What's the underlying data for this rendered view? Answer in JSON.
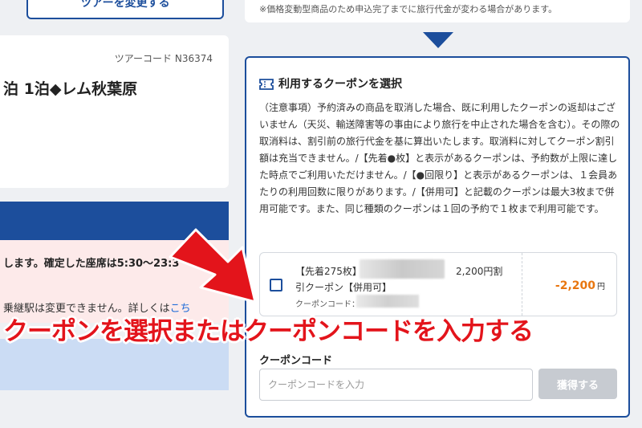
{
  "left": {
    "change_button": "ツアーを変更する",
    "tour_code": "ツアーコード N36374",
    "tour_title": "泊 1泊◆レム秋葉原",
    "notice_bold": "します。確定した座席は5:30〜23:3",
    "notice_text": "乗継駅は変更できません。詳しくは",
    "notice_link": "こち"
  },
  "right": {
    "price_note": "※価格変動型商品のため申込完了までに旅行代金が変わる場合があります。",
    "coupon_section": {
      "title": "利用するクーポンを選択",
      "notice": "（注意事項）予約済みの商品を取消した場合、既に利用したクーポンの返却はございません（天災、輸送障害等の事由により旅行を中止された場合を含む）。その際の取消料は、割引前の旅行代金を基に算出いたします。取消料に対してクーポン割引額は充当できません。/【先着●枚】と表示があるクーポンは、予約数が上限に達した時点でご利用いただけません。/【●回限り】と表示があるクーポンは、１会員あたりの利用回数に限りがあります。/【併用可】と記載のクーポンは最大3枚まで併用可能です。また、同じ種類のクーポンは１回の予約で１枚まで利用可能です。",
      "coupon": {
        "name_prefix": "【先着275枚】",
        "name_amount": "2,200円割",
        "name_suffix": "引クーポン【併用可】",
        "code_label": "クーポンコード：",
        "discount": "-2,200",
        "currency": "円"
      },
      "code_label": "クーポンコード",
      "code_placeholder": "クーポンコードを入力",
      "get_button": "獲得する"
    }
  },
  "annotation": "クーポンを選択またはクーポンコードを入力する",
  "colors": {
    "primary": "#1c4e9c",
    "discount": "#e8760f",
    "annotation": "#e3141b"
  }
}
